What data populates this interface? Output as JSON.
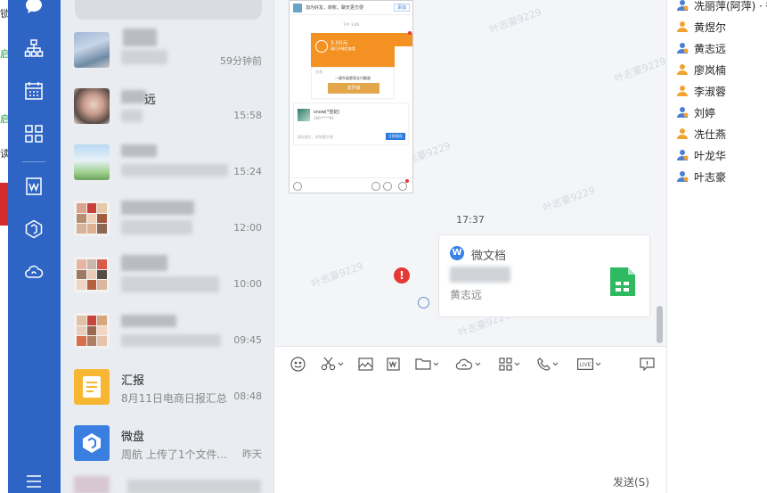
{
  "left_edge": {
    "chars": [
      "锁",
      "启",
      "启",
      "读"
    ]
  },
  "rail": {
    "items": [
      {
        "icon": "chat-bubble-icon"
      },
      {
        "icon": "org-chart-icon"
      },
      {
        "icon": "calendar-icon"
      },
      {
        "icon": "apps-grid-icon"
      },
      {
        "icon": "wedoc-icon"
      },
      {
        "icon": "wedrive-icon"
      },
      {
        "icon": "cloud-icon"
      },
      {
        "icon": "menu-icon"
      }
    ]
  },
  "conversations": [
    {
      "name": "",
      "preview": "",
      "time": "59分钟前"
    },
    {
      "name": "远",
      "preview": "",
      "time": "15:58"
    },
    {
      "name": "",
      "preview": "",
      "time": "15:24"
    },
    {
      "name": "",
      "preview": "",
      "time": "12:00"
    },
    {
      "name": "",
      "preview": "",
      "time": "10:00"
    },
    {
      "name": "",
      "preview": "",
      "time": "09:45"
    },
    {
      "name": "汇报",
      "preview": "8月11日电商日报汇总",
      "time": "08:48"
    },
    {
      "name": "微盘",
      "preview": "周航 上传了1个文件...",
      "time": "昨天"
    }
  ],
  "chat": {
    "phone_shot": {
      "top_text": "加为好友，转账，聊天更方便",
      "top_btn": "添加",
      "time": "下午 3:46",
      "amount": "3.00元",
      "sub": "请打开微信查看",
      "tag": "交易",
      "hint": "一键升级更高支付额度",
      "upgrade_btn": "去升级",
      "user_name": "snow(*芸妃)",
      "user_phone": "186*****95",
      "input_placeholder": "保存图片，转账更方便",
      "save_btn": "立即保存"
    },
    "time_label": "17:37",
    "doc_card": {
      "title": "微文档",
      "author": "黄志远"
    },
    "watermark": "叶志豪9229"
  },
  "toolbar": {
    "items": [
      {
        "icon": "emoji-icon"
      },
      {
        "icon": "scissors-icon"
      },
      {
        "icon": "image-icon"
      },
      {
        "icon": "wedoc-icon"
      },
      {
        "icon": "folder-icon"
      },
      {
        "icon": "cloud-share-icon"
      },
      {
        "icon": "apps-icon"
      },
      {
        "icon": "phone-icon"
      },
      {
        "icon": "live-icon"
      },
      {
        "icon": "screen-share-icon"
      }
    ],
    "send_label": "发送(S)"
  },
  "members": [
    {
      "name": "冼丽萍(阿萍) · 微",
      "role": "admin"
    },
    {
      "name": "黄煜尔",
      "role": "normal"
    },
    {
      "name": "黄志远",
      "role": "admin"
    },
    {
      "name": "廖岚楠",
      "role": "normal"
    },
    {
      "name": "李淑蓉",
      "role": "normal"
    },
    {
      "name": "刘婷",
      "role": "admin"
    },
    {
      "name": "冼仕燕",
      "role": "normal"
    },
    {
      "name": "叶龙华",
      "role": "admin"
    },
    {
      "name": "叶志豪",
      "role": "admin"
    }
  ],
  "colors": {
    "rail": "#2e65c4",
    "accent": "#3b82e6",
    "error": "#e53935",
    "member_admin": "#f0a330",
    "member_normal": "#4a7fd4"
  }
}
